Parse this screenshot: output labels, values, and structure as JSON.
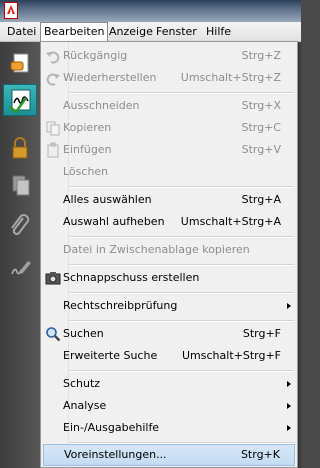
{
  "menubar": {
    "items": [
      "Datei",
      "Bearbeiten",
      "Anzeige",
      "Fenster",
      "Hilfe"
    ]
  },
  "menu": {
    "items": [
      {
        "label": "Rückgängig",
        "shortcut": "Strg+Z",
        "disabled": true,
        "icon": "undo-icon"
      },
      {
        "label": "Wiederherstellen",
        "shortcut": "Umschalt+Strg+Z",
        "disabled": true,
        "icon": "redo-icon"
      },
      {
        "label": "Ausschneiden",
        "shortcut": "Strg+X",
        "disabled": true
      },
      {
        "label": "Kopieren",
        "shortcut": "Strg+C",
        "disabled": true,
        "icon": "copy-icon"
      },
      {
        "label": "Einfügen",
        "shortcut": "Strg+V",
        "disabled": true,
        "icon": "paste-icon"
      },
      {
        "label": "Löschen",
        "shortcut": "",
        "disabled": true
      },
      {
        "label": "Alles auswählen",
        "shortcut": "Strg+A",
        "disabled": false
      },
      {
        "label": "Auswahl aufheben",
        "shortcut": "Umschalt+Strg+A",
        "disabled": false
      },
      {
        "label": "Datei in Zwischenablage kopieren",
        "shortcut": "",
        "disabled": true
      },
      {
        "label": "Schnappschuss erstellen",
        "shortcut": "",
        "disabled": false,
        "icon": "camera-icon"
      },
      {
        "label": "Rechtschreibprüfung",
        "shortcut": "",
        "disabled": false,
        "submenu": true
      },
      {
        "label": "Suchen",
        "shortcut": "Strg+F",
        "disabled": false,
        "icon": "search-icon"
      },
      {
        "label": "Erweiterte Suche",
        "shortcut": "Umschalt+Strg+F",
        "disabled": false
      },
      {
        "label": "Schutz",
        "shortcut": "",
        "disabled": false,
        "submenu": true
      },
      {
        "label": "Analyse",
        "shortcut": "",
        "disabled": false,
        "submenu": true
      },
      {
        "label": "Ein-/Ausgabehilfe",
        "shortcut": "",
        "disabled": false,
        "submenu": true
      },
      {
        "label": "Voreinstellungen...",
        "shortcut": "Strg+K",
        "disabled": false,
        "highlighted": true
      }
    ]
  }
}
